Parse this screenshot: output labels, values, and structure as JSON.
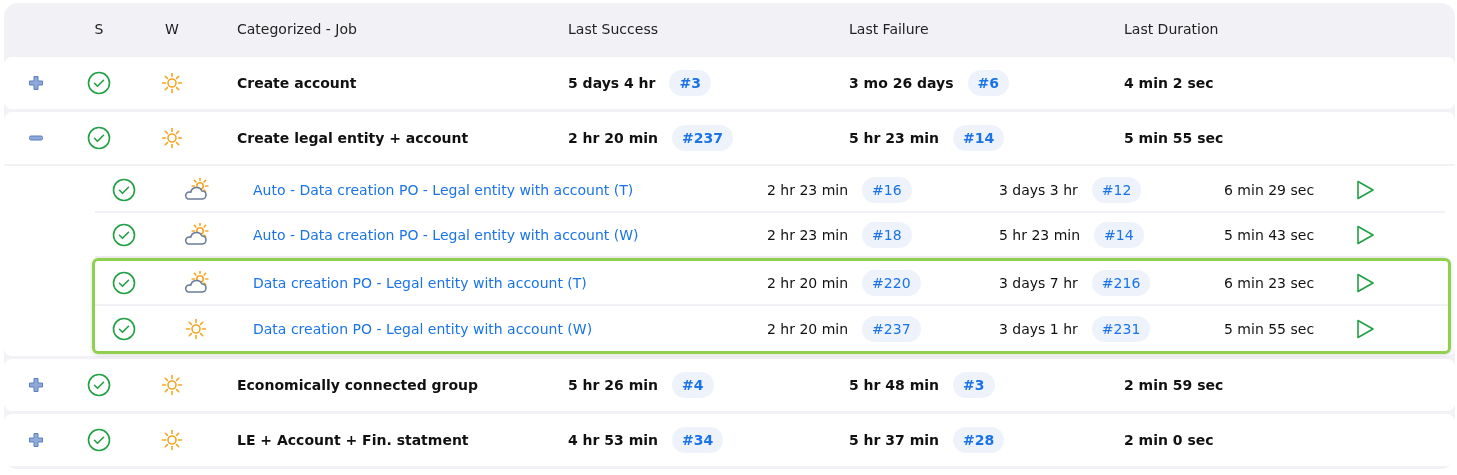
{
  "columns": [
    "S",
    "W",
    "Categorized - Job",
    "Last Success",
    "Last Failure",
    "Last Duration"
  ],
  "groups": [
    {
      "expanded": false,
      "status": {
        "kind": "success"
      },
      "weather": {
        "kind": "sunny"
      },
      "name": "Create account",
      "last_success": {
        "time": "5 days 4 hr",
        "build": "#3"
      },
      "last_failure": {
        "time": "3 mo 26 days",
        "build": "#6"
      },
      "duration": "4 min 2 sec"
    },
    {
      "expanded": true,
      "status": {
        "kind": "success"
      },
      "weather": {
        "kind": "sunny"
      },
      "name": "Create legal entity + account",
      "last_success": {
        "time": "2 hr 20 min",
        "build": "#237"
      },
      "last_failure": {
        "time": "5 hr 23 min",
        "build": "#14"
      },
      "duration": "5 min 55 sec",
      "children": [
        {
          "highlighted": false,
          "status": {
            "kind": "success"
          },
          "weather": {
            "kind": "partly-cloudy"
          },
          "name": "Auto - Data creation PO - Legal entity with account (T)",
          "last_success": {
            "time": "2 hr 23 min",
            "build": "#16"
          },
          "last_failure": {
            "time": "3 days 3 hr",
            "build": "#12"
          },
          "duration": "6 min 29 sec"
        },
        {
          "highlighted": false,
          "status": {
            "kind": "success"
          },
          "weather": {
            "kind": "partly-cloudy"
          },
          "name": "Auto - Data creation PO - Legal entity with account (W)",
          "last_success": {
            "time": "2 hr 23 min",
            "build": "#18"
          },
          "last_failure": {
            "time": "5 hr 23 min",
            "build": "#14"
          },
          "duration": "5 min 43 sec"
        },
        {
          "highlighted": true,
          "status": {
            "kind": "success"
          },
          "weather": {
            "kind": "partly-cloudy"
          },
          "name": "Data creation PO - Legal entity with account (T)",
          "last_success": {
            "time": "2 hr 20 min",
            "build": "#220"
          },
          "last_failure": {
            "time": "3 days 7 hr",
            "build": "#216"
          },
          "duration": "6 min 23 sec"
        },
        {
          "highlighted": true,
          "status": {
            "kind": "success"
          },
          "weather": {
            "kind": "sunny"
          },
          "name": "Data creation PO - Legal entity with account (W)",
          "last_success": {
            "time": "2 hr 20 min",
            "build": "#237"
          },
          "last_failure": {
            "time": "3 days 1 hr",
            "build": "#231"
          },
          "duration": "5 min 55 sec"
        }
      ]
    },
    {
      "expanded": false,
      "status": {
        "kind": "success"
      },
      "weather": {
        "kind": "sunny"
      },
      "name": "Economically connected group",
      "last_success": {
        "time": "5 hr 26 min",
        "build": "#4"
      },
      "last_failure": {
        "time": "5 hr 48 min",
        "build": "#3"
      },
      "duration": "2 min 59 sec"
    },
    {
      "expanded": false,
      "status": {
        "kind": "success"
      },
      "weather": {
        "kind": "sunny"
      },
      "name": "LE + Account + Fin. statment",
      "last_success": {
        "time": "4 hr 53 min",
        "build": "#34"
      },
      "last_failure": {
        "time": "5 hr 37 min",
        "build": "#28"
      },
      "duration": "2 min 0 sec"
    }
  ]
}
